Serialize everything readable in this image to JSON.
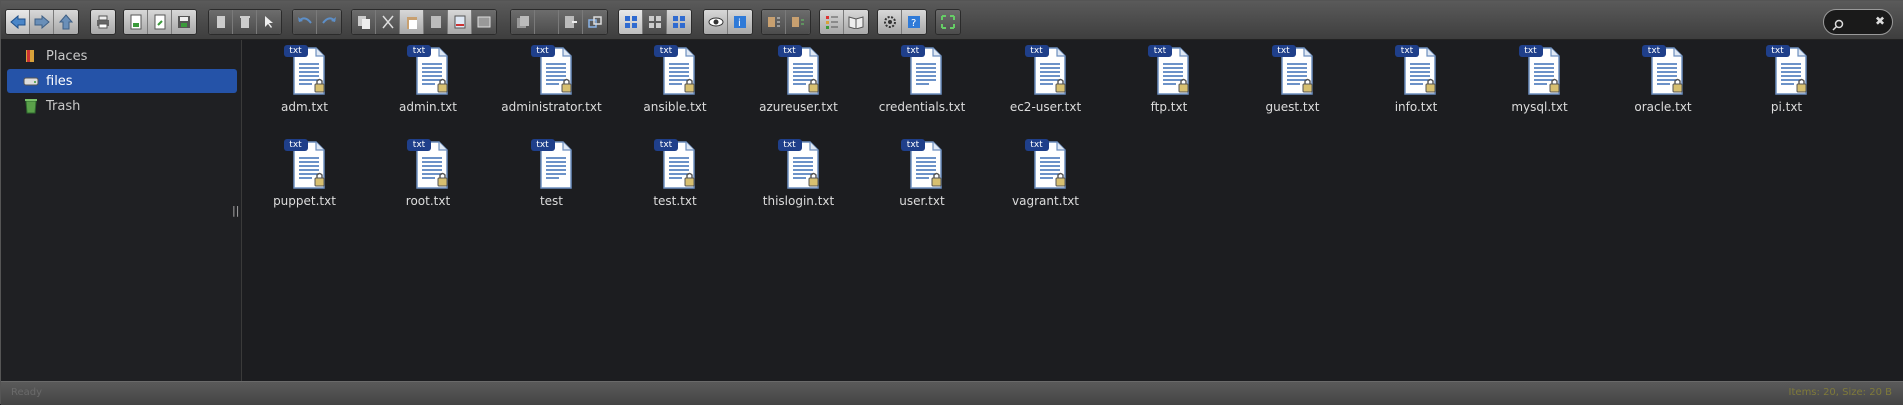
{
  "toolbar": {
    "icons": [
      "back-arrow-icon",
      "forward-arrow-icon",
      "up-arrow-icon",
      "print-icon",
      "new-icon",
      "new-document-icon",
      "save-icon",
      "bookmark-icon",
      "trash-icon",
      "cursor-icon",
      "undo-icon",
      "redo-icon",
      "copy-icon",
      "cut-icon",
      "paste-icon",
      "document-icon",
      "delete-icon",
      "image-icon",
      "stack-icon",
      "blank-icon",
      "doc-arrow-icon",
      "link-icon",
      "grid-large-icon",
      "grid-small-icon",
      "grid-icon",
      "eye-icon",
      "info-icon",
      "sort-icon",
      "sort2-icon",
      "list-icon",
      "book-icon",
      "settings-icon",
      "help-icon",
      "fullscreen-icon"
    ],
    "search_clear": "✖"
  },
  "sidebar": {
    "items": [
      {
        "label": "Places",
        "icon": "places-icon"
      },
      {
        "label": "files",
        "icon": "drive-icon"
      },
      {
        "label": "Trash",
        "icon": "trash-can-icon"
      }
    ],
    "handle": "||"
  },
  "files": [
    {
      "name": "adm.txt",
      "badge": "txt",
      "locked": true
    },
    {
      "name": "admin.txt",
      "badge": "txt",
      "locked": true
    },
    {
      "name": "administrator.txt",
      "badge": "txt",
      "locked": true
    },
    {
      "name": "ansible.txt",
      "badge": "txt",
      "locked": true
    },
    {
      "name": "azureuser.txt",
      "badge": "txt",
      "locked": true
    },
    {
      "name": "credentials.txt",
      "badge": "txt",
      "locked": false
    },
    {
      "name": "ec2-user.txt",
      "badge": "txt",
      "locked": true
    },
    {
      "name": "ftp.txt",
      "badge": "txt",
      "locked": true
    },
    {
      "name": "guest.txt",
      "badge": "txt",
      "locked": true
    },
    {
      "name": "info.txt",
      "badge": "txt",
      "locked": true
    },
    {
      "name": "mysql.txt",
      "badge": "txt",
      "locked": true
    },
    {
      "name": "oracle.txt",
      "badge": "txt",
      "locked": true
    },
    {
      "name": "pi.txt",
      "badge": "txt",
      "locked": true
    },
    {
      "name": "puppet.txt",
      "badge": "txt",
      "locked": true
    },
    {
      "name": "root.txt",
      "badge": "txt",
      "locked": true
    },
    {
      "name": "test",
      "badge": "txt",
      "locked": false
    },
    {
      "name": "test.txt",
      "badge": "txt",
      "locked": true
    },
    {
      "name": "thislogin.txt",
      "badge": "txt",
      "locked": true
    },
    {
      "name": "user.txt",
      "badge": "txt",
      "locked": true
    },
    {
      "name": "vagrant.txt",
      "badge": "txt",
      "locked": true
    }
  ],
  "status": {
    "left": "Ready",
    "right": "Items: 20, Size: 20 B"
  }
}
